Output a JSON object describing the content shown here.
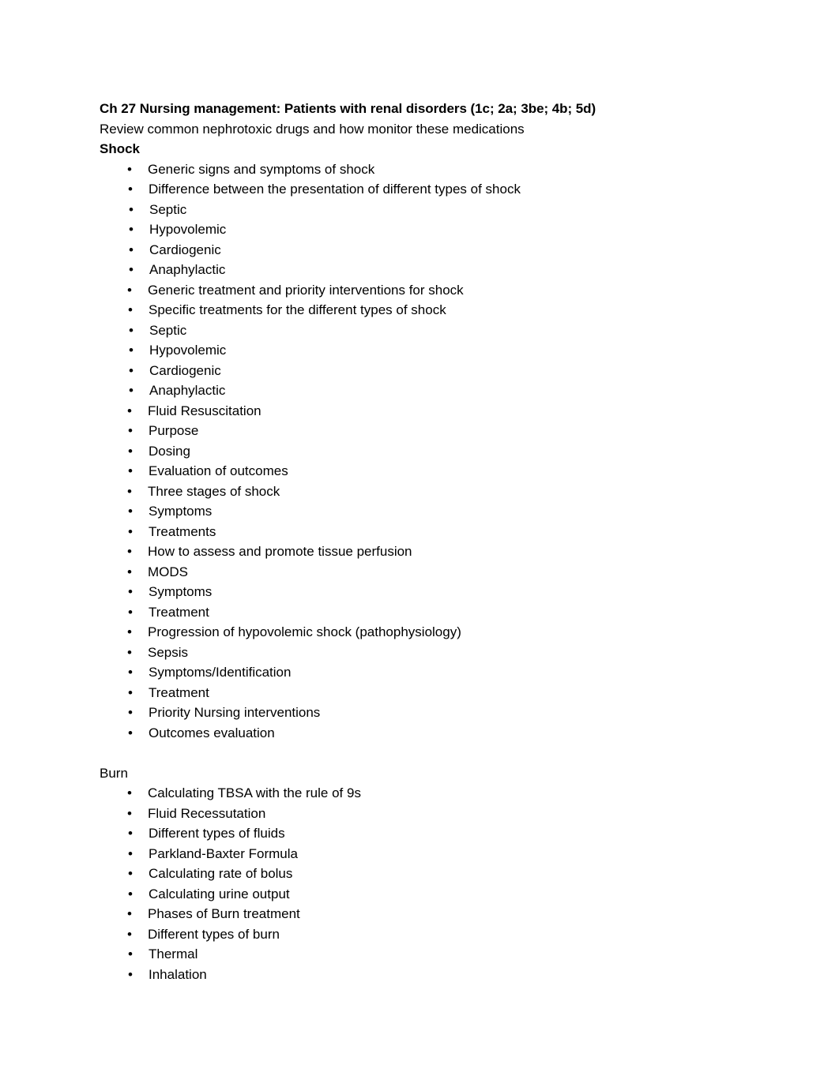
{
  "document": {
    "title": "Ch 27 Nursing management: Patients with renal disorders (1c; 2a; 3be; 4b; 5d)",
    "subtitle": "Review common nephrotoxic drugs and how monitor these medications",
    "bullet_glyph": "•",
    "text_color": "#000000",
    "background_color": "#ffffff"
  },
  "sections": [
    {
      "heading": "Shock",
      "heading_bold": true,
      "items": [
        {
          "level": 1,
          "text": "Generic signs and symptoms of shock"
        },
        {
          "level": 2,
          "text": "Difference between the presentation of different types of shock"
        },
        {
          "level": 3,
          "text": "Septic"
        },
        {
          "level": 3,
          "text": "Hypovolemic"
        },
        {
          "level": 3,
          "text": "Cardiogenic"
        },
        {
          "level": 3,
          "text": "Anaphylactic"
        },
        {
          "level": 1,
          "text": "Generic treatment and priority interventions for shock"
        },
        {
          "level": 2,
          "text": "Specific treatments for the different types of shock"
        },
        {
          "level": 3,
          "text": "Septic"
        },
        {
          "level": 3,
          "text": "Hypovolemic"
        },
        {
          "level": 3,
          "text": "Cardiogenic"
        },
        {
          "level": 3,
          "text": "Anaphylactic"
        },
        {
          "level": 1,
          "text": "Fluid Resuscitation"
        },
        {
          "level": 2,
          "text": "Purpose"
        },
        {
          "level": 2,
          "text": "Dosing"
        },
        {
          "level": 2,
          "text": "Evaluation of outcomes"
        },
        {
          "level": 1,
          "text": "Three stages of shock"
        },
        {
          "level": 2,
          "text": "Symptoms"
        },
        {
          "level": 2,
          "text": "Treatments"
        },
        {
          "level": 1,
          "text": "How to assess and promote tissue perfusion"
        },
        {
          "level": 1,
          "text": "MODS"
        },
        {
          "level": 2,
          "text": "Symptoms"
        },
        {
          "level": 2,
          "text": "Treatment"
        },
        {
          "level": 1,
          "text": "Progression of hypovolemic shock (pathophysiology)"
        },
        {
          "level": 1,
          "text": "Sepsis"
        },
        {
          "level": 2,
          "text": "Symptoms/Identification"
        },
        {
          "level": 2,
          "text": "Treatment"
        },
        {
          "level": 2,
          "text": "Priority Nursing interventions"
        },
        {
          "level": 2,
          "text": "Outcomes evaluation"
        }
      ]
    },
    {
      "heading": "Burn",
      "heading_bold": false,
      "items": [
        {
          "level": 1,
          "text": "Calculating TBSA with the rule of 9s"
        },
        {
          "level": 1,
          "text": "Fluid Recessutation"
        },
        {
          "level": 2,
          "text": "Different types of fluids"
        },
        {
          "level": 2,
          "text": "Parkland-Baxter Formula"
        },
        {
          "level": 2,
          "text": "Calculating rate of bolus"
        },
        {
          "level": 2,
          "text": "Calculating urine output"
        },
        {
          "level": 1,
          "text": "Phases of Burn treatment"
        },
        {
          "level": 1,
          "text": "Different types of burn"
        },
        {
          "level": 2,
          "text": "Thermal"
        },
        {
          "level": 2,
          "text": "Inhalation"
        }
      ]
    }
  ]
}
